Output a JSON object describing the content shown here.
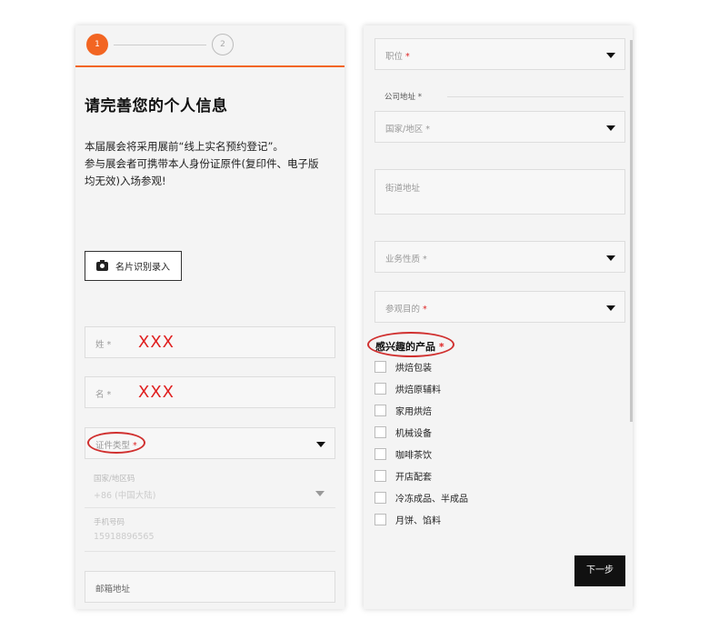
{
  "left": {
    "steps": [
      "1",
      "2"
    ],
    "title": "请完善您的个人信息",
    "notice": [
      "本届展会将采用展前“线上实名预约登记”。",
      "参与展会者可携带本人身份证原件(复印件、电子版",
      "均无效)入场参观!"
    ],
    "card_button": "名片识别录入",
    "surname": {
      "label": "姓",
      "required": "*",
      "value": "XXX"
    },
    "given_name": {
      "label": "名",
      "required": "*",
      "value": "XXX"
    },
    "id_type": {
      "label": "证件类型",
      "required": "*"
    },
    "country_code": {
      "label": "国家/地区码",
      "value": "+86 (中国大陆)"
    },
    "phone": {
      "label": "手机号码",
      "value": "15918896565"
    },
    "email": {
      "label": "邮箱地址"
    }
  },
  "right": {
    "position": {
      "label": "职位",
      "required": "*"
    },
    "company_address_label": "公司地址",
    "company_address_required": "*",
    "country": {
      "label": "国家/地区",
      "required": "*"
    },
    "street_placeholder": "街道地址",
    "business_type": {
      "label": "业务性质",
      "required": "*"
    },
    "visit_purpose": {
      "label": "参观目的",
      "required": "*"
    },
    "interest_title": "感兴趣的产品",
    "interest_required": "*",
    "products": [
      "烘焙包装",
      "烘焙原辅料",
      "家用烘焙",
      "机械设备",
      "咖啡茶饮",
      "开店配套",
      "冷冻成品、半成品",
      "月饼、馅料"
    ],
    "next_button": "下一步"
  },
  "colors": {
    "accent": "#f26522",
    "annotation": "#d0302f",
    "placeholder_value": "#e02020"
  }
}
